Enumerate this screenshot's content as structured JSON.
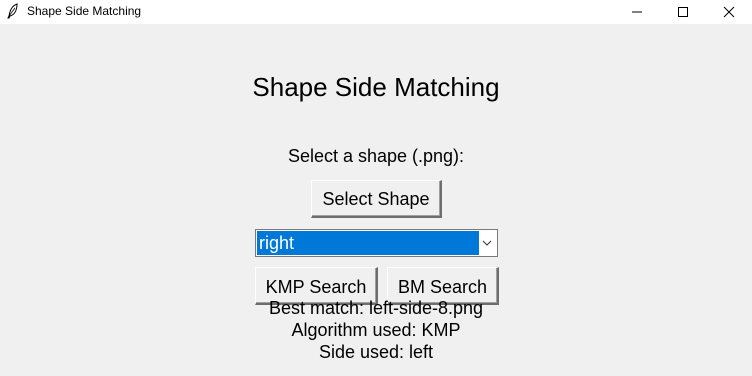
{
  "window": {
    "title": "Shape Side Matching",
    "icon": "feather-icon",
    "controls": [
      "minimize-icon",
      "maximize-icon",
      "close-icon"
    ]
  },
  "main": {
    "heading": "Shape Side Matching",
    "select_label": "Select a shape (.png):",
    "select_button": "Select Shape",
    "side_dropdown": {
      "selected": "right",
      "highlight_color": "#0078d7"
    },
    "kmp_button": "KMP Search",
    "bm_button": "BM Search"
  },
  "results": {
    "best_match": "Best match: left-side-8.png",
    "algorithm": "Algorithm used: KMP",
    "side": "Side used: left"
  }
}
